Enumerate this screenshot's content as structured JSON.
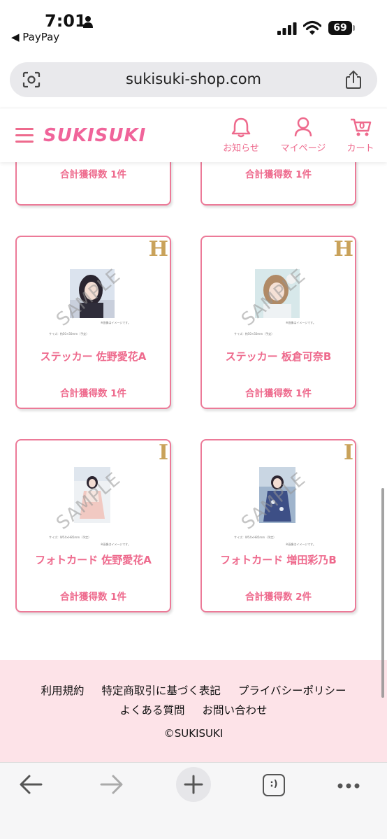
{
  "status_bar": {
    "time": "7:01",
    "back_app": "◀ PayPay",
    "battery": "69"
  },
  "browser": {
    "url": "sukisuki-shop.com"
  },
  "header": {
    "logo": "SUKISUKI",
    "nav": {
      "news": "お知らせ",
      "mypage": "マイページ",
      "cart": "カート",
      "cart_count": "0"
    },
    "accent_color": "#ee6a8d"
  },
  "cards_top": [
    {
      "count": "合計獲得数 1件"
    },
    {
      "count": "合計獲得数 1件"
    }
  ],
  "cards": [
    {
      "rank": "H",
      "title": "ステッカー 佐野愛花A",
      "count": "合計獲得数 1件",
      "watermark": "SAMPLE",
      "caption_top": "※画像はイメージです。",
      "caption_size": "サイズ：約50×50mm（予定）"
    },
    {
      "rank": "H",
      "title": "ステッカー 板倉可奈B",
      "count": "合計獲得数 1件",
      "watermark": "SAMPLE",
      "caption_top": "※画像はイメージです。",
      "caption_size": "サイズ：約50×50mm（予定）"
    },
    {
      "rank": "I",
      "title": "フォトカード 佐野愛花A",
      "count": "合計獲得数 1件",
      "watermark": "SAMPLE",
      "caption_top": "※画像はイメージです。",
      "caption_size": "サイズ：W54×H85mm（予定）"
    },
    {
      "rank": "I",
      "title": "フォトカード 増田彩乃B",
      "count": "合計獲得数 2件",
      "watermark": "SAMPLE",
      "caption_top": "※画像はイメージです。",
      "caption_size": "サイズ：W54×H85mm（予定）"
    }
  ],
  "footer": {
    "terms": "利用規約",
    "commerce": "特定商取引に基づく表記",
    "privacy": "プライバシーポリシー",
    "faq": "よくある質問",
    "contact": "お問い合わせ",
    "copyright": "©SUKISUKI"
  },
  "toolbar": {
    "tabs_glyph": ":)"
  }
}
